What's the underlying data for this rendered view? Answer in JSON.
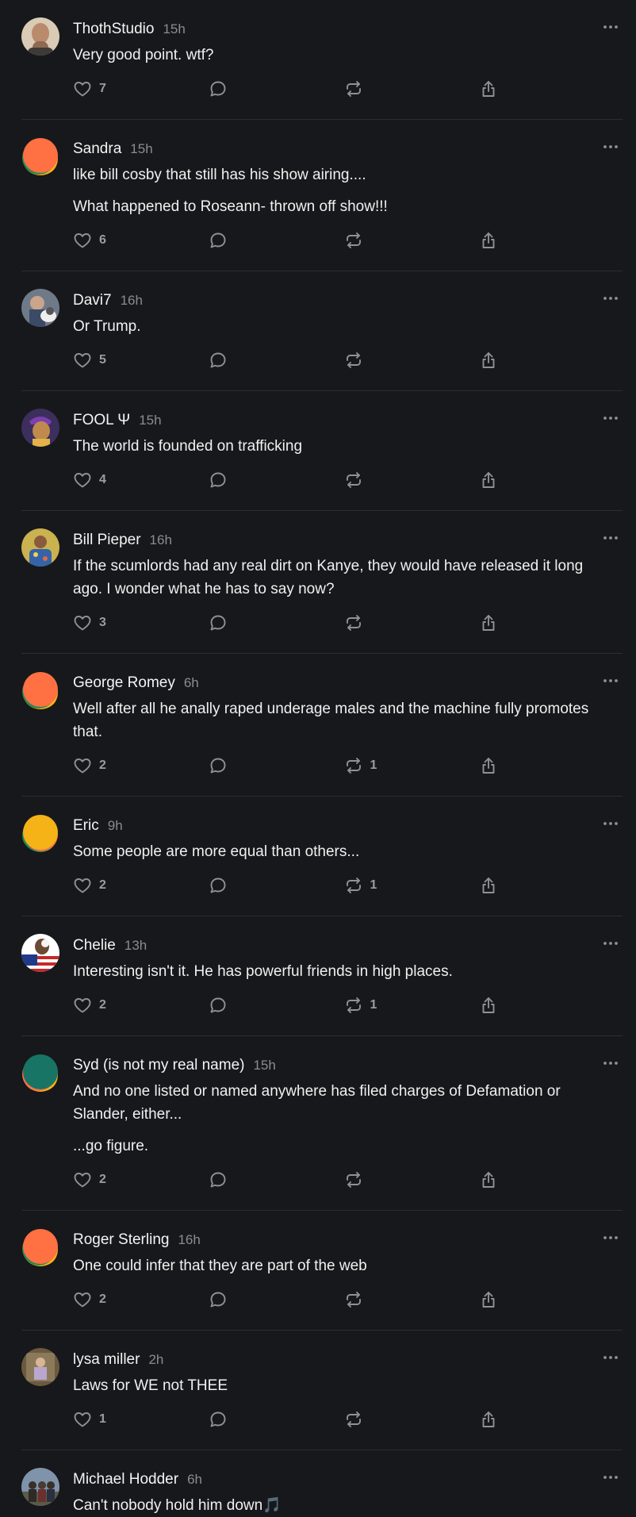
{
  "comments": [
    {
      "author": "ThothStudio",
      "time": "15h",
      "avatar": "photo-bald-man",
      "text": [
        "Very good point. wtf?"
      ],
      "likes": "7",
      "reposts": ""
    },
    {
      "author": "Sandra",
      "time": "15h",
      "avatar": "default-orange",
      "text": [
        "like bill cosby that still has his show airing....",
        "What happened to Roseann- thrown off show!!!"
      ],
      "likes": "6",
      "reposts": ""
    },
    {
      "author": "Davi7",
      "time": "16h",
      "avatar": "photo-person-dog",
      "text": [
        "Or Trump."
      ],
      "likes": "5",
      "reposts": ""
    },
    {
      "author": "FOOL Ψ",
      "time": "15h",
      "avatar": "photo-illustrated-pirate",
      "text": [
        "The world is founded on trafficking"
      ],
      "likes": "4",
      "reposts": ""
    },
    {
      "author": "Bill Pieper",
      "time": "16h",
      "avatar": "photo-man-flower-shirt",
      "text": [
        "If the scumlords had any real dirt on Kanye, they would have released it long ago. I wonder what he has to say now?"
      ],
      "likes": "3",
      "reposts": ""
    },
    {
      "author": "George Romey",
      "time": "6h",
      "avatar": "default-orange",
      "text": [
        "Well after all he anally raped underage males and the machine fully promotes that."
      ],
      "likes": "2",
      "reposts": "1"
    },
    {
      "author": "Eric",
      "time": "9h",
      "avatar": "default-yellow",
      "text": [
        "Some people are more equal than others..."
      ],
      "likes": "2",
      "reposts": "1"
    },
    {
      "author": "Chelie",
      "time": "13h",
      "avatar": "photo-eagle-flag",
      "text": [
        "Interesting isn't it. He has powerful friends in high places."
      ],
      "likes": "2",
      "reposts": "1"
    },
    {
      "author": "Syd (is not my real name)",
      "time": "15h",
      "avatar": "default-teal",
      "text": [
        "And no one listed or named anywhere has filed charges of Defamation or Slander, either...",
        "...go figure."
      ],
      "likes": "2",
      "reposts": ""
    },
    {
      "author": "Roger Sterling",
      "time": "16h",
      "avatar": "default-orange",
      "text": [
        "One could infer that they are part of the web"
      ],
      "likes": "2",
      "reposts": ""
    },
    {
      "author": "lysa miller",
      "time": "2h",
      "avatar": "photo-woman-seated",
      "text": [
        "Laws for WE not THEE"
      ],
      "likes": "1",
      "reposts": ""
    },
    {
      "author": "Michael Hodder",
      "time": "6h",
      "avatar": "photo-group-people",
      "text": [
        "Can't nobody hold him down🎵"
      ],
      "likes": "1",
      "reposts": ""
    }
  ],
  "colors": {
    "background": "#17181b",
    "divider": "#2b2d31",
    "icon": "#8f9196",
    "time": "#8a8c90",
    "text": "#f0f0f0"
  },
  "icons": [
    "heart-icon",
    "comment-bubble-icon",
    "repost-icon",
    "share-icon",
    "more-dots-icon"
  ]
}
